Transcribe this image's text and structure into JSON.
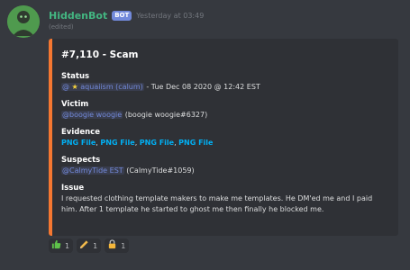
{
  "message": {
    "author": "HiddenBot",
    "bot_tag": "BOT",
    "timestamp": "Yesterday at 03:49",
    "content": "(edited)"
  },
  "embed": {
    "accent_color": "#f57731",
    "title": "#7,110 - Scam",
    "fields": {
      "status": {
        "name": "Status",
        "mention_prefix": "@",
        "mention_name": " aquaiism (calum)",
        "rest": " - Tue Dec 08 2020 @ 12:42 EST"
      },
      "victim": {
        "name": "Victim",
        "mention": "@boogie woogie",
        "rest": " (boogie woogie#6327)"
      },
      "evidence": {
        "name": "Evidence",
        "links": [
          "PNG File",
          "PNG File",
          "PNG File",
          "PNG File"
        ]
      },
      "suspects": {
        "name": "Suspects",
        "mention": "@CalmyTide EST",
        "rest": " (CalmyTide#1059)"
      },
      "issue": {
        "name": "Issue",
        "text": "I requested clothing template makers to make me templates. He DM'ed me and I paid him. After 1 template he started to ghost me then finally he blocked me."
      }
    }
  },
  "reactions": [
    {
      "icon": "thumbs-up-icon",
      "count": "1"
    },
    {
      "icon": "pencil-icon",
      "count": "1"
    },
    {
      "icon": "lock-icon",
      "count": "1"
    }
  ]
}
